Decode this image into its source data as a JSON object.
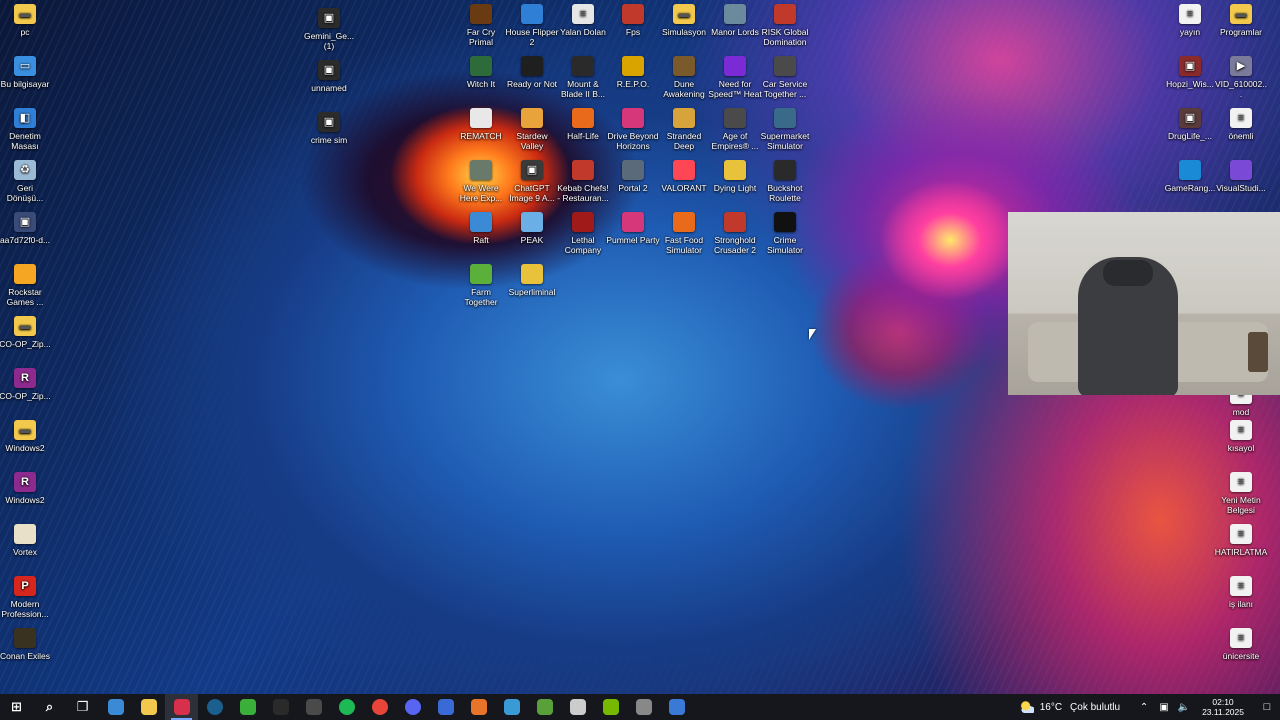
{
  "desktop": {
    "left_icons": [
      {
        "label": "pc",
        "icon": "folder-icon",
        "color": "#f2c94c"
      },
      {
        "label": "Bu bilgisayar",
        "icon": "computer-icon",
        "color": "#3b8fe0"
      },
      {
        "label": "Denetim Masası",
        "icon": "control-panel-icon",
        "color": "#2f7fd6"
      },
      {
        "label": "Geri Dönüşü...",
        "icon": "recycle-bin-icon",
        "color": "#9bbad6"
      },
      {
        "label": "aa7d72f0-d...",
        "icon": "image-file-icon",
        "color": "#3a4b7a"
      },
      {
        "label": "Rockstar Games ...",
        "icon": "rockstar-icon",
        "color": "#f5a623"
      },
      {
        "label": "CO-OP_Zip...",
        "icon": "folder-icon",
        "color": "#f2c94c"
      },
      {
        "label": "CO-OP_Zip...",
        "icon": "winrar-icon",
        "color": "#8e2a8f"
      },
      {
        "label": "Windows2",
        "icon": "folder-icon",
        "color": "#f2c94c"
      },
      {
        "label": "Windows2",
        "icon": "winrar-icon",
        "color": "#8e2a8f"
      },
      {
        "label": "Vortex",
        "icon": "vortex-icon",
        "color": "#e8e0c8"
      },
      {
        "label": "Modern Profession...",
        "icon": "pdf-icon",
        "color": "#d7261e"
      },
      {
        "label": "Conan Exiles",
        "icon": "conan-icon",
        "color": "#3a3220"
      }
    ],
    "col2_icons": [
      {
        "label": "Gemini_Ge... (1)",
        "icon": "image-file-icon",
        "color": "#2b2b2b"
      },
      {
        "label": "unnamed",
        "icon": "image-file-icon",
        "color": "#2b2b2b"
      },
      {
        "label": "crime sim",
        "icon": "image-file-icon",
        "color": "#2b2b2b"
      }
    ],
    "grid_icons": [
      {
        "label": "Far Cry Primal",
        "icon": "far-cry-icon",
        "color": "#6a3a12"
      },
      {
        "label": "House Flipper 2",
        "icon": "house-flipper-icon",
        "color": "#2f7fd6"
      },
      {
        "label": "Yalan Dolan",
        "icon": "document-icon",
        "color": "#e6e6e6"
      },
      {
        "label": "Fps",
        "icon": "fps-icon",
        "color": "#c0392b"
      },
      {
        "label": "Simulasyon",
        "icon": "folder-icon",
        "color": "#f2c94c"
      },
      {
        "label": "Manor Lords",
        "icon": "manor-lords-icon",
        "color": "#6b8a9e"
      },
      {
        "label": "RISK Global Domination",
        "icon": "risk-icon",
        "color": "#c0392b"
      },
      {
        "label": "Witch It",
        "icon": "witch-it-icon",
        "color": "#2e6b3a"
      },
      {
        "label": "Ready or Not",
        "icon": "ready-or-not-icon",
        "color": "#1f1f1f"
      },
      {
        "label": "Mount & Blade II B...",
        "icon": "mount-blade-icon",
        "color": "#2a2a2a"
      },
      {
        "label": "R.E.P.O.",
        "icon": "repo-icon",
        "color": "#d9a400"
      },
      {
        "label": "Dune Awakening",
        "icon": "dune-icon",
        "color": "#7a5a2a"
      },
      {
        "label": "Need for Speed™ Heat",
        "icon": "nfs-icon",
        "color": "#7a2bd6"
      },
      {
        "label": "Car Service Together ...",
        "icon": "car-service-icon",
        "color": "#4a4a4a"
      },
      {
        "label": "REMATCH",
        "icon": "rematch-icon",
        "color": "#e8e8e8"
      },
      {
        "label": "Stardew Valley",
        "icon": "stardew-icon",
        "color": "#e8a33a"
      },
      {
        "label": "Half-Life",
        "icon": "half-life-icon",
        "color": "#e86a1a"
      },
      {
        "label": "Drive Beyond Horizons",
        "icon": "drive-beyond-icon",
        "color": "#d6377a"
      },
      {
        "label": "Stranded Deep",
        "icon": "stranded-deep-icon",
        "color": "#d6a43a"
      },
      {
        "label": "Age of Empires® ...",
        "icon": "aoe-icon",
        "color": "#4a4a4a"
      },
      {
        "label": "Supermarket Simulator",
        "icon": "supermarket-icon",
        "color": "#3a6a8a"
      },
      {
        "label": "We Were Here Exp...",
        "icon": "we-were-here-icon",
        "color": "#6a7a6a"
      },
      {
        "label": "ChatGPT Image 9 A...",
        "icon": "image-file-icon",
        "color": "#3a3a3a"
      },
      {
        "label": "Kebab Chefs! - Restauran...",
        "icon": "kebab-chefs-icon",
        "color": "#c0392b"
      },
      {
        "label": "Portal 2",
        "icon": "portal-icon",
        "color": "#5a6a7a"
      },
      {
        "label": "VALORANT",
        "icon": "valorant-icon",
        "color": "#ff4655"
      },
      {
        "label": "Dying Light",
        "icon": "dying-light-icon",
        "color": "#e8c23a"
      },
      {
        "label": "Buckshot Roulette",
        "icon": "buckshot-icon",
        "color": "#2a2a2a"
      },
      {
        "label": "Raft",
        "icon": "raft-icon",
        "color": "#3a8ad6"
      },
      {
        "label": "PEAK",
        "icon": "peak-icon",
        "color": "#6ab0e6"
      },
      {
        "label": "Lethal Company",
        "icon": "lethal-company-icon",
        "color": "#a01a1a"
      },
      {
        "label": "Pummel Party",
        "icon": "pummel-party-icon",
        "color": "#d6377a"
      },
      {
        "label": "Fast Food Simulator",
        "icon": "fast-food-icon",
        "color": "#e86a1a"
      },
      {
        "label": "Stronghold Crusader 2",
        "icon": "stronghold-icon",
        "color": "#c0392b"
      },
      {
        "label": "Crime Simulator",
        "icon": "crime-sim-icon",
        "color": "#111111"
      },
      {
        "label": "Farm Together",
        "icon": "farm-together-icon",
        "color": "#5ab03a"
      },
      {
        "label": "Superliminal",
        "icon": "superliminal-icon",
        "color": "#e8c23a"
      }
    ],
    "right_icons": [
      {
        "label": "yayın",
        "icon": "document-icon",
        "color": "#f2f2f2"
      },
      {
        "label": "Programlar",
        "icon": "folder-icon",
        "color": "#f2c94c"
      },
      {
        "label": "Hopzi_Wis...",
        "icon": "image-file-icon",
        "color": "#8a2a2a"
      },
      {
        "label": "VID_610002...",
        "icon": "video-file-icon",
        "color": "#7a7a9a"
      },
      {
        "label": "DrugLife_...",
        "icon": "image-file-icon",
        "color": "#5a3a3a"
      },
      {
        "label": "önemli",
        "icon": "document-icon",
        "color": "#f2f2f2"
      },
      {
        "label": "GameRang...",
        "icon": "gameranger-icon",
        "color": "#1a8ad6"
      },
      {
        "label": "VisualStudi...",
        "icon": "visual-studio-icon",
        "color": "#7a4ad6"
      },
      {
        "label": "mod",
        "icon": "document-icon",
        "color": "#f2f2f2"
      },
      {
        "label": "kısayol",
        "icon": "document-icon",
        "color": "#f2f2f2"
      },
      {
        "label": "Yeni Metin Belgesi",
        "icon": "document-icon",
        "color": "#f2f2f2"
      },
      {
        "label": "HATIRLATMA",
        "icon": "document-icon",
        "color": "#f2f2f2"
      },
      {
        "label": "iş ilanı",
        "icon": "document-icon",
        "color": "#f2f2f2"
      },
      {
        "label": "ünicersite",
        "icon": "document-icon",
        "color": "#f2f2f2"
      }
    ]
  },
  "taskbar": {
    "apps": [
      {
        "icon": "windows-start-icon",
        "color": "#ffffff"
      },
      {
        "icon": "search-icon",
        "color": "#ffffff"
      },
      {
        "icon": "task-view-icon",
        "color": "#ffffff"
      },
      {
        "icon": "copilot-icon",
        "color": "#3a8ad6"
      },
      {
        "icon": "file-explorer-icon",
        "color": "#f2c94c"
      },
      {
        "icon": "opera-gx-icon",
        "color": "#d6304a",
        "active": true
      },
      {
        "icon": "steam-icon",
        "color": "#1b5f8f"
      },
      {
        "icon": "xbox-icon",
        "color": "#3ab03a"
      },
      {
        "icon": "epic-games-icon",
        "color": "#2a2a2a"
      },
      {
        "icon": "obs-icon",
        "color": "#4a4a4a"
      },
      {
        "icon": "spotify-icon",
        "color": "#1db954"
      },
      {
        "icon": "chrome-icon",
        "color": "#e8453a"
      },
      {
        "icon": "discord-icon",
        "color": "#5865f2"
      },
      {
        "icon": "browser-icon",
        "color": "#3a6ad6"
      },
      {
        "icon": "blender-icon",
        "color": "#e8742a"
      },
      {
        "icon": "capture-icon",
        "color": "#3a9ad6"
      },
      {
        "icon": "minecraft-icon",
        "color": "#5aa03a"
      },
      {
        "icon": "unity-icon",
        "color": "#cccccc"
      },
      {
        "icon": "nvidia-icon",
        "color": "#76b900"
      },
      {
        "icon": "steam-big-picture-icon",
        "color": "#888888"
      },
      {
        "icon": "notes-icon",
        "color": "#3a7ad6"
      }
    ],
    "weather": {
      "temp": "16°C",
      "desc": "Çok bulutlu"
    },
    "tray_icons": [
      "chevron-up-icon",
      "network-icon",
      "volume-icon"
    ],
    "clock": {
      "time": "02:10",
      "date": "23.11.2025"
    }
  }
}
